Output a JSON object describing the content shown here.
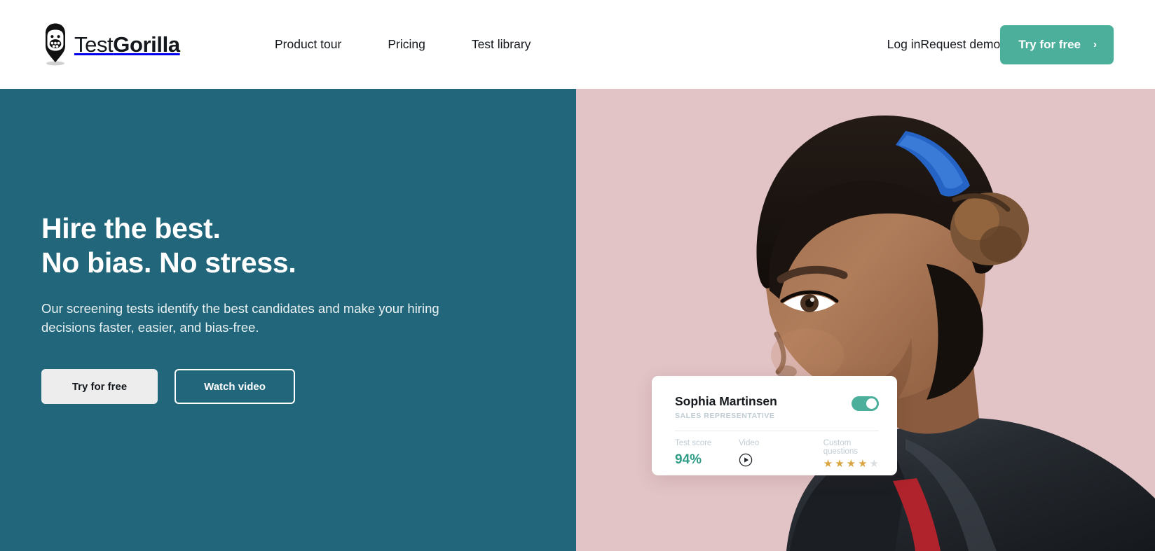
{
  "brand": {
    "logo_text_light": "Test",
    "logo_text_bold": "Gorilla",
    "logo_icon": "gorilla-pin-logo",
    "accent_green": "#4CAF9B",
    "hero_teal": "#21667A",
    "hero_pink": "#E3C4C6",
    "score_green": "#2F9C86",
    "star_gold": "#D9A441"
  },
  "header": {
    "nav_links": [
      {
        "label": "Product tour"
      },
      {
        "label": "Pricing"
      },
      {
        "label": "Test library"
      }
    ],
    "login_label": "Log in",
    "request_demo_label": "Request demo",
    "cta_label": "Try for free",
    "cta_chevron": "›"
  },
  "hero": {
    "title_line1": "Hire the best.",
    "title_line2": "No bias. No stress.",
    "subtitle": "Our screening tests identify the best candidates and make your hiring decisions faster, easier, and bias-free.",
    "primary_button": "Try for free",
    "secondary_button": "Watch video",
    "photo_alt": "smiling-sales-representative-photo"
  },
  "candidate_card": {
    "name": "Sophia Martinsen",
    "role": "SALES REPRESENTATIVE",
    "toggle_state": "on",
    "metrics": {
      "test_score_label": "Test score",
      "test_score_value": "94",
      "test_score_unit": "%",
      "video_label": "Video",
      "video_icon": "play-circle-icon",
      "custom_questions_label": "Custom questions",
      "custom_questions_rating": 4,
      "custom_questions_max": 5,
      "star_glyph": "★"
    }
  }
}
